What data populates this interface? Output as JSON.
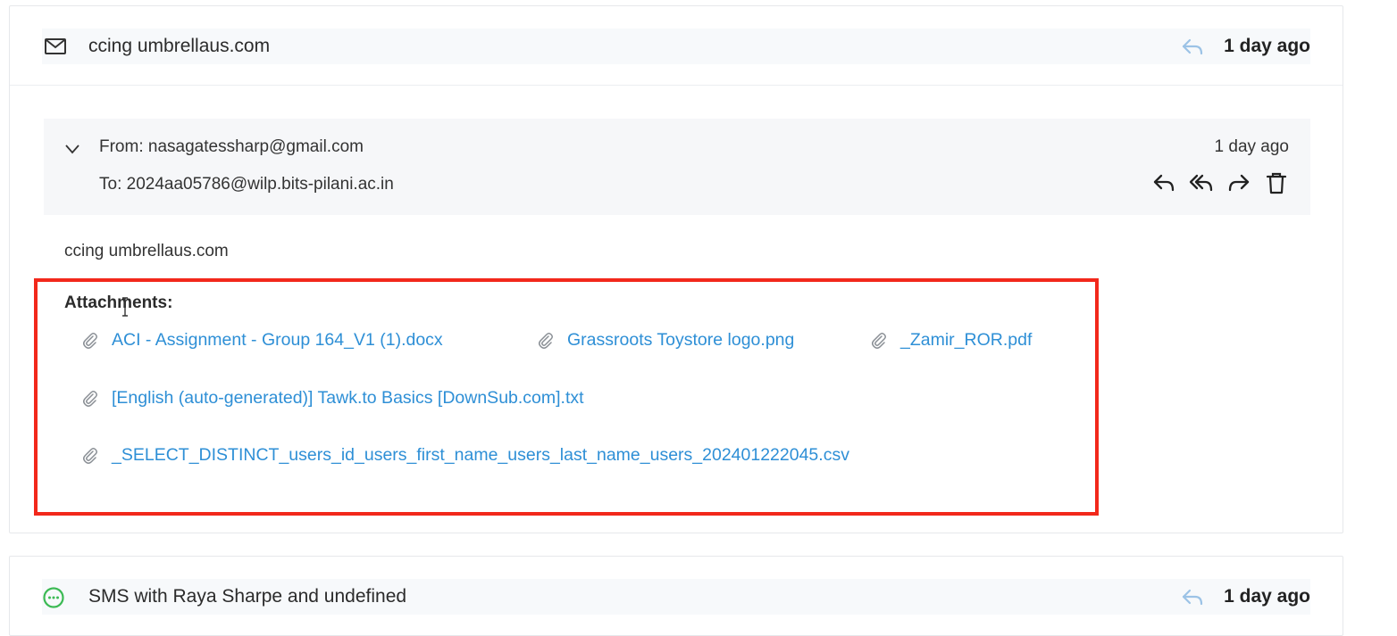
{
  "threads": [
    {
      "title": "ccing umbrellaus.com",
      "time": "1 day ago",
      "icon": "mail-icon"
    },
    {
      "title": "SMS with Raya Sharpe and undefined",
      "time": "1 day ago",
      "icon": "sms-icon"
    }
  ],
  "message": {
    "from": "From: nasagatessharp@gmail.com",
    "to": "To: 2024aa05786@wilp.bits-pilani.ac.in",
    "time": "1 day ago",
    "actions": [
      "reply-icon",
      "reply-all-icon",
      "forward-icon",
      "trash-icon"
    ],
    "body": "ccing umbrellaus.com",
    "attachments_label": "Attachments:",
    "attachments": [
      "ACI - Assignment - Group 164_V1 (1).docx",
      "Grassroots Toystore logo.png",
      "_Zamir_ROR.pdf",
      "[English (auto-generated)] Tawk.to Basics [DownSub.com].txt",
      "_SELECT_DISTINCT_users_id_users_first_name_users_last_name_users_202401222045.csv"
    ]
  },
  "colors": {
    "link": "#2e8fd6",
    "highlight_border": "#f2281b",
    "sms_green": "#3cba54",
    "reply_soft": "#9cc3e6"
  }
}
